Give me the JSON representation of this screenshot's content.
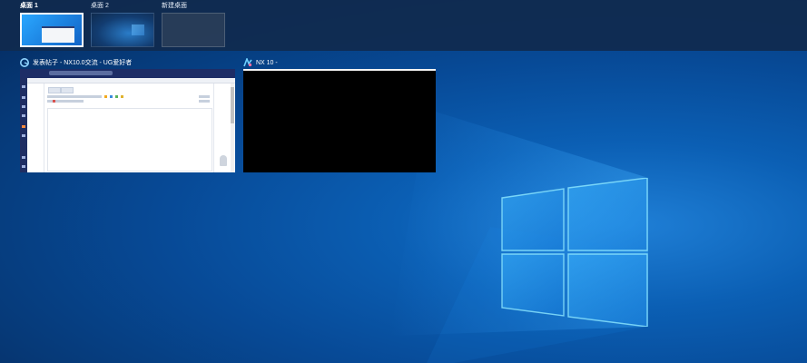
{
  "desktops": [
    {
      "label": "桌面 1",
      "active": true
    },
    {
      "label": "桌面 2",
      "active": false
    },
    {
      "label": "新建桌面",
      "active": false
    }
  ],
  "windows": [
    {
      "title": "发表帖子 - NX10.0交流 - UG爱好者",
      "icon": "browser-icon"
    },
    {
      "title": "NX 10 -",
      "icon": "nx-icon"
    }
  ],
  "colors": {
    "desktop_blue": "#0b5fb4",
    "task_bar_overlay": "#102a4e",
    "active_desktop_border": "#ffffff"
  }
}
